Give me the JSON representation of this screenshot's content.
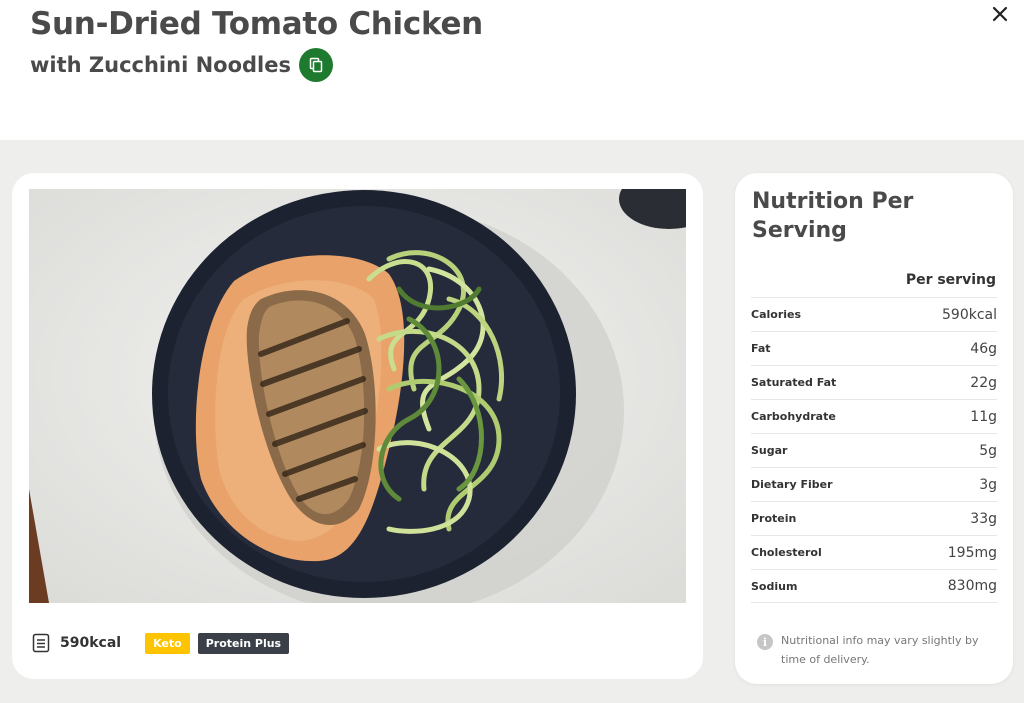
{
  "recipe": {
    "title": "Sun-Dried Tomato Chicken",
    "subtitle": "with Zucchini Noodles"
  },
  "meal": {
    "calories": "590kcal",
    "tags": [
      "Keto",
      "Protein Plus"
    ]
  },
  "nutrition": {
    "heading": "Nutrition Per Serving",
    "column_header": "Per serving",
    "rows": [
      {
        "label": "Calories",
        "value": "590kcal"
      },
      {
        "label": "Fat",
        "value": "46g"
      },
      {
        "label": "Saturated Fat",
        "value": "22g"
      },
      {
        "label": "Carbohydrate",
        "value": "11g"
      },
      {
        "label": "Sugar",
        "value": "5g"
      },
      {
        "label": "Dietary Fiber",
        "value": "3g"
      },
      {
        "label": "Protein",
        "value": "33g"
      },
      {
        "label": "Cholesterol",
        "value": "195mg"
      },
      {
        "label": "Sodium",
        "value": "830mg"
      }
    ],
    "note": "Nutritional info may vary slightly by time of delivery."
  },
  "colors": {
    "copy_button": "#1e7a2e",
    "keto_tag": "#ffc400",
    "protein_tag": "#3a3f48",
    "background": "#eeefed"
  },
  "icons": {
    "close": "close-icon",
    "copy": "copy-icon",
    "calories": "document-icon",
    "info": "info-icon"
  }
}
